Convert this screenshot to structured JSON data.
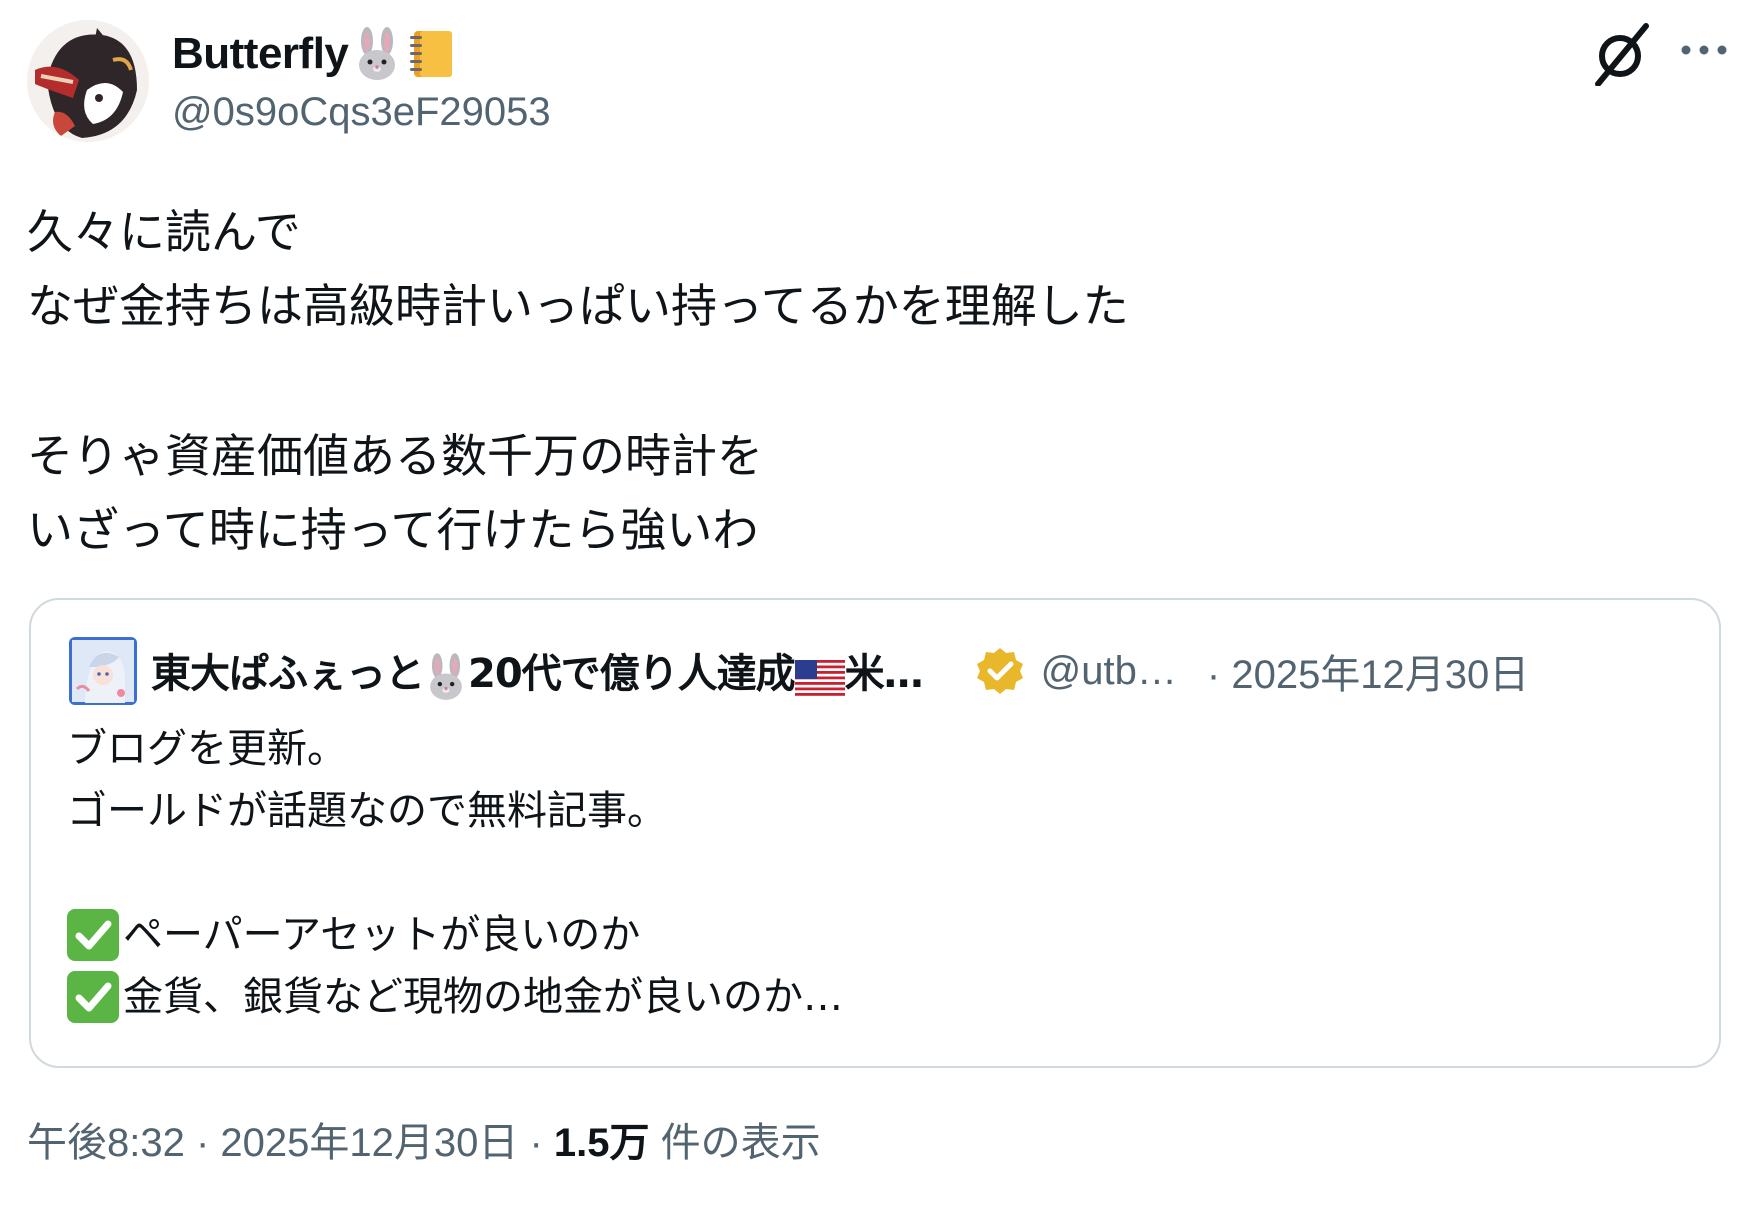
{
  "author": {
    "display_name": "Butterfly",
    "name_emojis": [
      "rabbit-face-emoji",
      "notebook-emoji"
    ],
    "handle": "@0s9oCqs3eF29053"
  },
  "header_actions": {
    "grok_icon": "grok-icon",
    "more_icon": "more-icon"
  },
  "tweet": {
    "lines": [
      "久々に読んで",
      "なぜ金持ちは高級時計いっぱい持ってるかを理解した",
      "",
      "そりゃ資産価値ある数千万の時計を",
      "いざって時に持って行けたら強いわ"
    ]
  },
  "quote": {
    "name_part1": "東大ぱふぇっと",
    "name_part2": "20代で億り人達成",
    "name_part3": "米…",
    "name_emojis": [
      "rabbit-face-emoji",
      "us-flag-emoji"
    ],
    "verified": true,
    "handle": "@utb…",
    "date": "· 2025年12月30日",
    "lines": [
      "ブログを更新。",
      "ゴールドが話題なので無料記事。",
      "",
      "ペーパーアセットが良いのか",
      "金貨、銀貨など現物の地金が良いのか…"
    ]
  },
  "meta": {
    "time": "午後8:32",
    "separator1": " · ",
    "date": "2025年12月30日",
    "separator2": " · ",
    "views_count": "1.5万",
    "views_label": " 件の表示"
  },
  "colors": {
    "text": "#0f1419",
    "secondary": "#536471",
    "border": "#cfd9de",
    "verified_gold": "#e8b82a",
    "check_green": "#5bb544"
  }
}
